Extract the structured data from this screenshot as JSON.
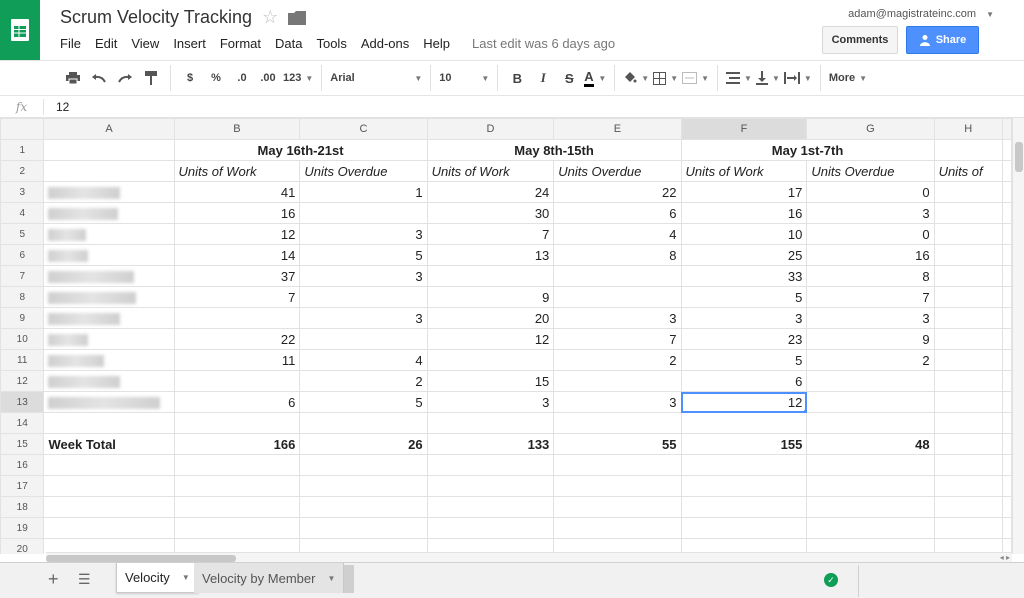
{
  "app": {
    "title": "Scrum Velocity Tracking",
    "account": "adam@magistrateinc.com",
    "last_edit": "Last edit was 6 days ago",
    "comments_label": "Comments",
    "share_label": "Share",
    "brand_color": "#0f9d58",
    "accent_color": "#4d90fe"
  },
  "menu": [
    "File",
    "Edit",
    "View",
    "Insert",
    "Format",
    "Data",
    "Tools",
    "Add-ons",
    "Help"
  ],
  "toolbar": {
    "currency": "$",
    "percent": "%",
    "decrease_decimals": ".0",
    "increase_decimals": ".00",
    "more_formats": "123",
    "font": "Arial",
    "font_size": "10",
    "bold": "B",
    "italic": "I",
    "strikethrough": "S",
    "text_color": "A",
    "more": "More"
  },
  "formula_bar": {
    "fx_label": "fx",
    "value": "12"
  },
  "grid": {
    "columns": [
      "A",
      "B",
      "C",
      "D",
      "E",
      "F",
      "G",
      "H"
    ],
    "selected_column": "F",
    "selected_row": "13",
    "rows": [
      {
        "n": "1",
        "a": "",
        "b": "May 16th-21st",
        "c": "",
        "d": "May 8th-15th",
        "e": "",
        "f": "May 1st-7th",
        "g": "",
        "h": ""
      },
      {
        "n": "2",
        "a": "",
        "b": "Units of Work",
        "c": "Units Overdue",
        "d": "Units of Work",
        "e": "Units Overdue",
        "f": "Units of Work",
        "g": "Units Overdue",
        "h": "Units of"
      },
      {
        "n": "3",
        "a": "",
        "b": "41",
        "c": "1",
        "d": "24",
        "e": "22",
        "f": "17",
        "g": "0",
        "h": ""
      },
      {
        "n": "4",
        "a": "",
        "b": "16",
        "c": "",
        "d": "30",
        "e": "6",
        "f": "16",
        "g": "3",
        "h": ""
      },
      {
        "n": "5",
        "a": "",
        "b": "12",
        "c": "3",
        "d": "7",
        "e": "4",
        "f": "10",
        "g": "0",
        "h": ""
      },
      {
        "n": "6",
        "a": "",
        "b": "14",
        "c": "5",
        "d": "13",
        "e": "8",
        "f": "25",
        "g": "16",
        "h": ""
      },
      {
        "n": "7",
        "a": "",
        "b": "37",
        "c": "3",
        "d": "",
        "e": "",
        "f": "33",
        "g": "8",
        "h": ""
      },
      {
        "n": "8",
        "a": "",
        "b": "7",
        "c": "",
        "d": "9",
        "e": "",
        "f": "5",
        "g": "7",
        "h": ""
      },
      {
        "n": "9",
        "a": "",
        "b": "",
        "c": "3",
        "d": "20",
        "e": "3",
        "f": "3",
        "g": "3",
        "h": ""
      },
      {
        "n": "10",
        "a": "",
        "b": "22",
        "c": "",
        "d": "12",
        "e": "7",
        "f": "23",
        "g": "9",
        "h": ""
      },
      {
        "n": "11",
        "a": "",
        "b": "11",
        "c": "4",
        "d": "",
        "e": "2",
        "f": "5",
        "g": "2",
        "h": ""
      },
      {
        "n": "12",
        "a": "",
        "b": "",
        "c": "2",
        "d": "15",
        "e": "",
        "f": "6",
        "g": "",
        "h": ""
      },
      {
        "n": "13",
        "a": "",
        "b": "6",
        "c": "5",
        "d": "3",
        "e": "3",
        "f": "12",
        "g": "",
        "h": ""
      },
      {
        "n": "14",
        "a": "",
        "b": "",
        "c": "",
        "d": "",
        "e": "",
        "f": "",
        "g": "",
        "h": ""
      },
      {
        "n": "15",
        "a": "Week Total",
        "b": "166",
        "c": "26",
        "d": "133",
        "e": "55",
        "f": "155",
        "g": "48",
        "h": ""
      },
      {
        "n": "16",
        "a": "",
        "b": "",
        "c": "",
        "d": "",
        "e": "",
        "f": "",
        "g": "",
        "h": ""
      },
      {
        "n": "17",
        "a": "",
        "b": "",
        "c": "",
        "d": "",
        "e": "",
        "f": "",
        "g": "",
        "h": ""
      },
      {
        "n": "18",
        "a": "",
        "b": "",
        "c": "",
        "d": "",
        "e": "",
        "f": "",
        "g": "",
        "h": ""
      },
      {
        "n": "19",
        "a": "",
        "b": "",
        "c": "",
        "d": "",
        "e": "",
        "f": "",
        "g": "",
        "h": ""
      },
      {
        "n": "20",
        "a": "",
        "b": "",
        "c": "",
        "d": "",
        "e": "",
        "f": "",
        "g": "",
        "h": ""
      }
    ]
  },
  "sheets": {
    "tabs": [
      "Velocity",
      "Velocity by Member"
    ],
    "active": "Velocity"
  }
}
